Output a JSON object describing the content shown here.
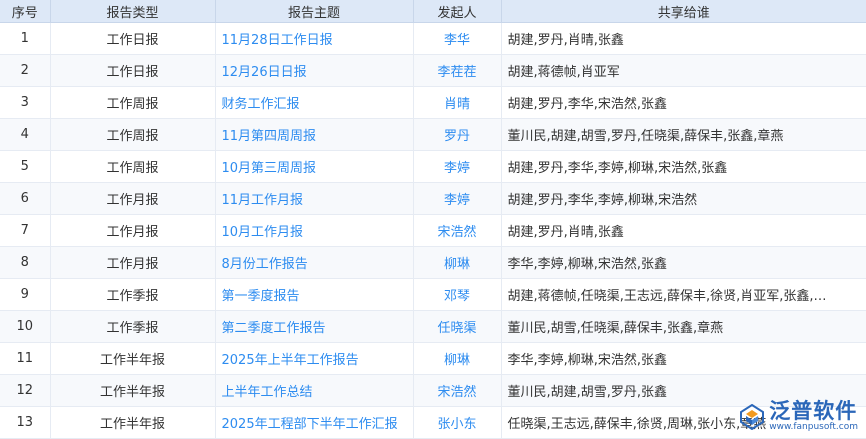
{
  "columns": {
    "no": "序号",
    "type": "报告类型",
    "topic": "报告主题",
    "initiator": "发起人",
    "shared_with": "共享给谁"
  },
  "rows": [
    {
      "no": "1",
      "type": "工作日报",
      "topic": "11月28日工作日报",
      "initiator": "李华",
      "shared_with": "胡建,罗丹,肖晴,张鑫"
    },
    {
      "no": "2",
      "type": "工作日报",
      "topic": "12月26日日报",
      "initiator": "李茬茬",
      "shared_with": "胡建,蒋德帧,肖亚军"
    },
    {
      "no": "3",
      "type": "工作周报",
      "topic": "财务工作汇报",
      "initiator": "肖晴",
      "shared_with": "胡建,罗丹,李华,宋浩然,张鑫"
    },
    {
      "no": "4",
      "type": "工作周报",
      "topic": "11月第四周周报",
      "initiator": "罗丹",
      "shared_with": "董川民,胡建,胡雪,罗丹,任晓渠,薛保丰,张鑫,章燕"
    },
    {
      "no": "5",
      "type": "工作周报",
      "topic": "10月第三周周报",
      "initiator": "李婷",
      "shared_with": "胡建,罗丹,李华,李婷,柳琳,宋浩然,张鑫"
    },
    {
      "no": "6",
      "type": "工作月报",
      "topic": "11月工作月报",
      "initiator": "李婷",
      "shared_with": "胡建,罗丹,李华,李婷,柳琳,宋浩然"
    },
    {
      "no": "7",
      "type": "工作月报",
      "topic": "10月工作月报",
      "initiator": "宋浩然",
      "shared_with": "胡建,罗丹,肖晴,张鑫"
    },
    {
      "no": "8",
      "type": "工作月报",
      "topic": "8月份工作报告",
      "initiator": "柳琳",
      "shared_with": "李华,李婷,柳琳,宋浩然,张鑫"
    },
    {
      "no": "9",
      "type": "工作季报",
      "topic": "第一季度报告",
      "initiator": "邓琴",
      "shared_with": "胡建,蒋德帧,任晓渠,王志远,薛保丰,徐贤,肖亚军,张鑫,…"
    },
    {
      "no": "10",
      "type": "工作季报",
      "topic": "第二季度工作报告",
      "initiator": "任晓渠",
      "shared_with": "董川民,胡雪,任晓渠,薛保丰,张鑫,章燕"
    },
    {
      "no": "11",
      "type": "工作半年报",
      "topic": "2025年上半年工作报告",
      "initiator": "柳琳",
      "shared_with": "李华,李婷,柳琳,宋浩然,张鑫"
    },
    {
      "no": "12",
      "type": "工作半年报",
      "topic": "上半年工作总结",
      "initiator": "宋浩然",
      "shared_with": "董川民,胡建,胡雪,罗丹,张鑫"
    },
    {
      "no": "13",
      "type": "工作半年报",
      "topic": "2025年工程部下半年工作汇报",
      "initiator": "张小东",
      "shared_with": "任晓渠,王志远,薛保丰,徐贤,周琳,张小东,章燕"
    }
  ],
  "watermark": {
    "brand": "泛普软件",
    "url": "www.fanpusoft.com",
    "logo_icon": "fanpu-logo-icon",
    "color": "#2b67b9"
  },
  "colors": {
    "header_bg": "#dde8f7",
    "link": "#2d8cf0"
  }
}
